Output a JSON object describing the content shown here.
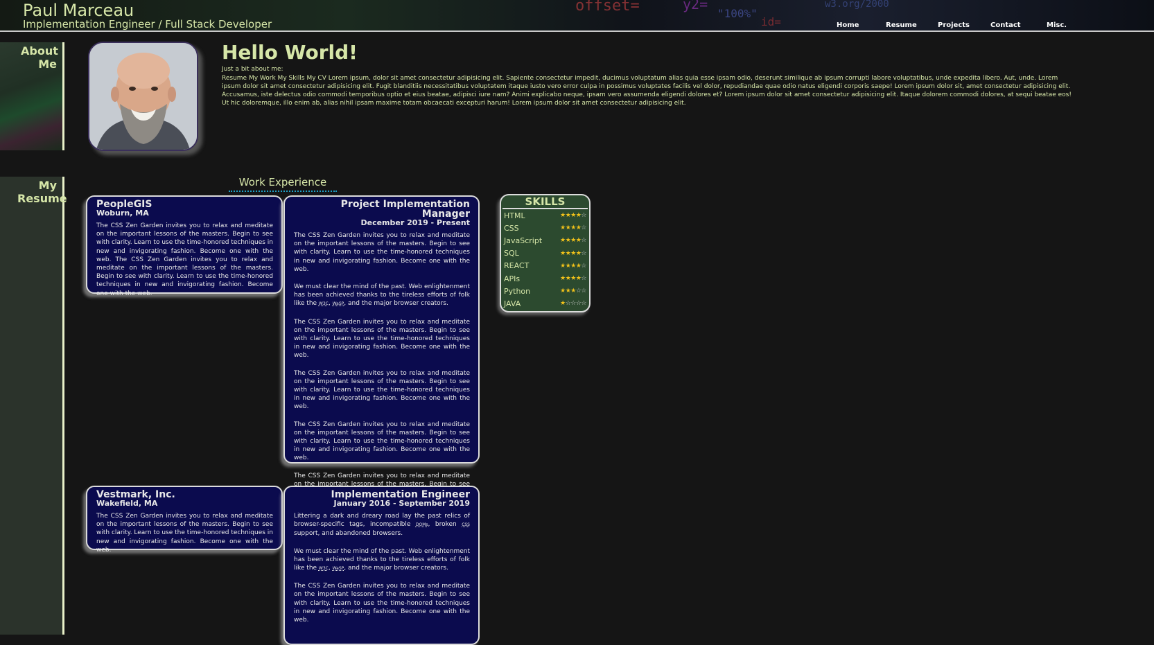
{
  "header": {
    "name": "Paul Marceau",
    "subtitle": "Implementation Engineer / Full Stack Developer",
    "background_code": [
      "offset=",
      "y2=",
      "\"100%\"",
      "id=",
      "w3.org/2000"
    ],
    "nav": [
      "Home",
      "Resume",
      "Projects",
      "Contact",
      "Misc."
    ]
  },
  "sidebar": {
    "about_label": "About Me",
    "resume_label": "My Resume"
  },
  "about": {
    "heading": "Hello World!",
    "label": "Just a bit about me:",
    "text": "Resume My Work My Skills My CV Lorem ipsum, dolor sit amet consectetur adipisicing elit. Sapiente consectetur impedit, ducimus voluptatum alias quia esse ipsam odio, deserunt similique ab ipsum corrupti labore voluptatibus, unde expedita libero. Aut, unde. Lorem ipsum dolor sit amet consectetur adipisicing elit. Fugit blanditiis necessitatibus voluptatem itaque iusto vero error culpa in possimus voluptates facilis vel dolor, repudiandae quae odio natus eligendi corporis saepe! Lorem ipsum dolor sit, amet consectetur adipisicing elit. Accusamus, iste delectus odio commodi temporibus optio et eius beatae, adipisci iure nam? Animi explicabo neque, ipsam vero assumenda eligendi dolores et? Lorem ipsum dolor sit amet consectetur adipisicing elit. Itaque dolorem commodi dolores, at sequi beatae eos! Ut hic doloremque, illo enim ab, alias nihil ipsam maxime totam obcaecati excepturi harum! Lorem ipsum dolor sit amet consectetur adipisicing elit."
  },
  "work": {
    "title": "Work Experience",
    "jobs": [
      {
        "company": "PeopleGIS",
        "location": "Woburn, MA",
        "company_text": "The CSS Zen Garden invites you to relax and meditate on the important lessons of the masters. Begin to see with clarity. Learn to use the time-honored techniques in new and invigorating fashion. Become one with the web. The CSS Zen Garden invites you to relax and meditate on the important lessons of the masters. Begin to see with clarity. Learn to use the time-honored techniques in new and invigorating fashion. Become one with the web.",
        "role": "Project Implementation Manager",
        "dates": "December 2019 - Present",
        "role_paragraphs": [
          "The CSS Zen Garden invites you to relax and meditate on the important lessons of the masters. Begin to see with clarity. Learn to use the time-honored techniques in new and invigorating fashion. Become one with the web.",
          {
            "pre": "We must clear the mind of the past. Web enlightenment has been achieved thanks to the tireless efforts of folk like the ",
            "a1": "W3C",
            "mid": ", ",
            "a2": "WaSP",
            "post": ", and the major browser creators."
          },
          "The CSS Zen Garden invites you to relax and meditate on the important lessons of the masters. Begin to see with clarity. Learn to use the time-honored techniques in new and invigorating fashion. Become one with the web.",
          "The CSS Zen Garden invites you to relax and meditate on the important lessons of the masters. Begin to see with clarity. Learn to use the time-honored techniques in new and invigorating fashion. Become one with the web.",
          "The CSS Zen Garden invites you to relax and meditate on the important lessons of the masters. Begin to see with clarity. Learn to use the time-honored techniques in new and invigorating fashion. Become one with the web.",
          "The CSS Zen Garden invites you to relax and meditate on the important lessons of the masters. Begin to see with clarity. Learn to use the time-honored techniques in new and invigorating fashion. Become one with the web."
        ]
      },
      {
        "company": "Vestmark, Inc.",
        "location": "Wakefield, MA",
        "company_text": "The CSS Zen Garden invites you to relax and meditate on the important lessons of the masters. Begin to see with clarity. Learn to use the time-honored techniques in new and invigorating fashion. Become one with the web.",
        "role": "Implementation Engineer",
        "dates": "January 2016 - September 2019",
        "role_paragraphs": [
          {
            "pre": "Littering a dark and dreary road lay the past relics of browser-specific tags, incompatible ",
            "a1": "DOMs",
            "mid": ", broken ",
            "a2": "CSS",
            "post": " support, and abandoned browsers."
          },
          {
            "pre": "We must clear the mind of the past. Web enlightenment has been achieved thanks to the tireless efforts of folk like the ",
            "a1": "W3C",
            "mid": ", ",
            "a2": "WaSP",
            "post": ", and the major browser creators."
          },
          "The CSS Zen Garden invites you to relax and meditate on the important lessons of the masters. Begin to see with clarity. Learn to use the time-honored techniques in new and invigorating fashion. Become one with the web."
        ]
      }
    ]
  },
  "skills": {
    "title": "SKILLS",
    "items": [
      {
        "name": "HTML",
        "rating": 4,
        "max": 5
      },
      {
        "name": "CSS",
        "rating": 4,
        "max": 5
      },
      {
        "name": "JavaScript",
        "rating": 4,
        "max": 5
      },
      {
        "name": "SQL",
        "rating": 4,
        "max": 5
      },
      {
        "name": "REACT",
        "rating": 4,
        "max": 5
      },
      {
        "name": "APIs",
        "rating": 4,
        "max": 5
      },
      {
        "name": "Python",
        "rating": 3,
        "max": 5
      },
      {
        "name": "JAVA",
        "rating": 1,
        "max": 5
      }
    ]
  },
  "colors": {
    "background": "#151515",
    "accent_text": "#d6e6a8",
    "card_background": "#0b0b4e",
    "skills_background": "#2c4a2f",
    "star": "#f2c21a",
    "work_underline": "#1ea0c8"
  }
}
